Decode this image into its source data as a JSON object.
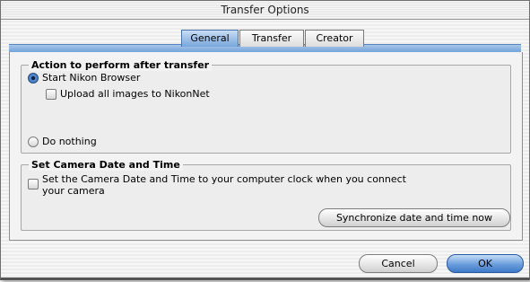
{
  "window": {
    "title": "Transfer Options"
  },
  "tabs": [
    {
      "label": "General",
      "selected": true
    },
    {
      "label": "Transfer",
      "selected": false
    },
    {
      "label": "Creator",
      "selected": false
    }
  ],
  "action_group": {
    "title": "Action to perform after transfer",
    "start_browser": {
      "label": "Start Nikon Browser",
      "selected": true
    },
    "upload": {
      "label": "Upload all images to NikonNet",
      "checked": false
    },
    "do_nothing": {
      "label": "Do nothing",
      "selected": false
    }
  },
  "date_group": {
    "title": "Set Camera Date and Time",
    "set_date": {
      "label_line1": "Set the Camera Date and Time to your computer clock when you connect",
      "label_line2": "your camera",
      "checked": false
    },
    "sync_button": "Synchronize date and time now"
  },
  "footer": {
    "cancel": "Cancel",
    "ok": "OK"
  },
  "colors": {
    "accent": "#6e9fd6",
    "default_button": "#3f79c8"
  }
}
